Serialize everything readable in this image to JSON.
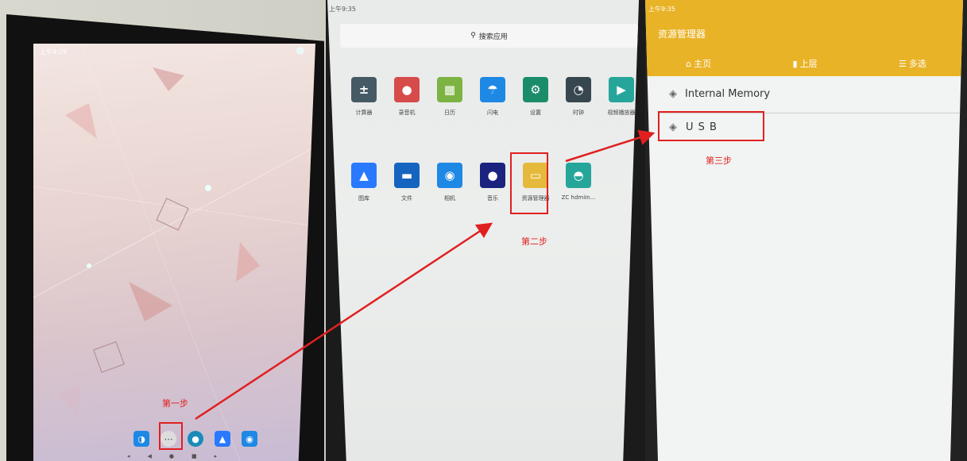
{
  "panel1": {
    "status_time": "上午9:29",
    "dock_icons": [
      "browser-icon",
      "apps-launcher-icon",
      "music-icon",
      "gallery-icon",
      "camera-icon"
    ],
    "nav": [
      "◀",
      "●",
      "■"
    ],
    "step_label": "第一步"
  },
  "panel2": {
    "status_time": "上午9:35",
    "search_placeholder": "搜索应用",
    "apps_row1": [
      {
        "label": "计算器",
        "icon": "calculator-icon",
        "color": "#455a64",
        "glyph": "±"
      },
      {
        "label": "录音机",
        "icon": "recorder-icon",
        "color": "#d84b4b",
        "glyph": "●"
      },
      {
        "label": "日历",
        "icon": "calendar-icon",
        "color": "#7cb342",
        "glyph": "▦"
      },
      {
        "label": "闪电",
        "icon": "lightning-icon",
        "color": "#1e88e5",
        "glyph": "☂"
      },
      {
        "label": "设置",
        "icon": "settings-icon",
        "color": "#1b8c6a",
        "glyph": "⚙"
      },
      {
        "label": "时钟",
        "icon": "clock-icon",
        "color": "#37474f",
        "glyph": "◔"
      },
      {
        "label": "视频播放器",
        "icon": "video-player-icon",
        "color": "#26a69a",
        "glyph": "▶"
      }
    ],
    "apps_row2": [
      {
        "label": "图库",
        "icon": "gallery-icon",
        "color": "#2979ff",
        "glyph": "▲"
      },
      {
        "label": "文件",
        "icon": "files-icon",
        "color": "#1565c0",
        "glyph": "▬"
      },
      {
        "label": "相机",
        "icon": "camera-icon",
        "color": "#1e88e5",
        "glyph": "◉"
      },
      {
        "label": "音乐",
        "icon": "music-icon",
        "color": "#1a237e",
        "glyph": "●"
      },
      {
        "label": "资源管理器",
        "icon": "file-manager-icon",
        "color": "#e5b93c",
        "glyph": "▭"
      },
      {
        "label": "ZC hdmiIn...",
        "icon": "android-icon",
        "color": "#26a69a",
        "glyph": "◓"
      }
    ],
    "step_label": "第二步"
  },
  "panel3": {
    "status_time": "上午9:35",
    "title": "资源管理器",
    "tabs": [
      {
        "label": "主页",
        "icon": "home-icon",
        "glyph": "⌂"
      },
      {
        "label": "上层",
        "icon": "folder-up-icon",
        "glyph": "▮"
      },
      {
        "label": "多选",
        "icon": "multiselect-icon",
        "glyph": "☰"
      }
    ],
    "rows": [
      {
        "label": "Internal Memory",
        "icon": "storage-icon"
      },
      {
        "label": "U S B",
        "icon": "usb-storage-icon"
      }
    ],
    "step_label": "第三步",
    "header_color": "#e9b328"
  },
  "annotation_color": "#e02020"
}
